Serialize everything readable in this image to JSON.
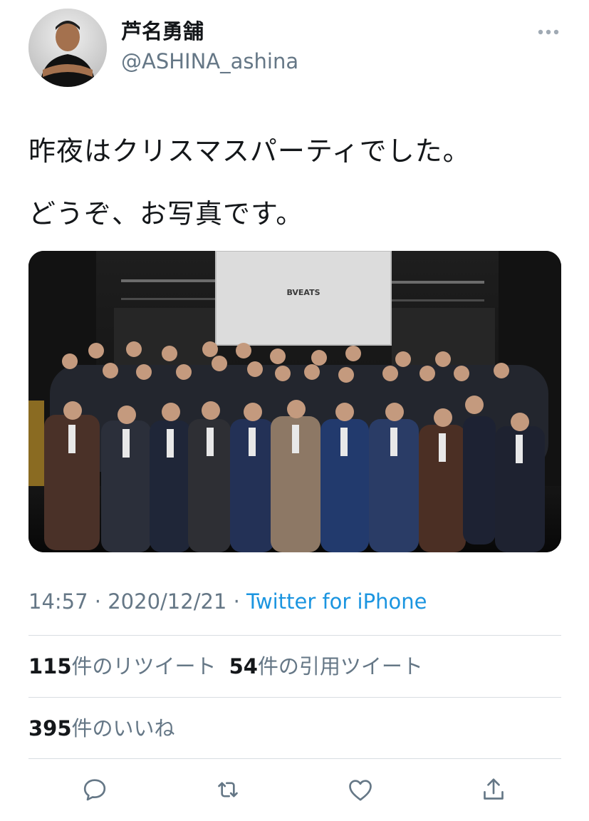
{
  "user": {
    "display_name": "芦名勇舗",
    "handle": "@ASHINA_ashina",
    "avatar_icon": "profile-photo"
  },
  "header": {
    "more_icon": "more-horizontal-icon"
  },
  "tweet": {
    "lines": [
      "昨夜はクリスマスパーティでした。",
      "どうぞ、お写真です。"
    ]
  },
  "photo": {
    "screen_text": "BVEATS"
  },
  "meta": {
    "time": "14:57",
    "sep1": " · ",
    "date": "2020/12/21",
    "sep2": " · ",
    "source": "Twitter for iPhone"
  },
  "stats": {
    "retweets_count": "115",
    "retweets_label": "件のリツイート",
    "quotes_count": "54",
    "quotes_label": "件の引用ツイート",
    "likes_count": "395",
    "likes_label": "件のいいね"
  },
  "actions": {
    "reply_icon": "reply-icon",
    "retweet_icon": "retweet-icon",
    "like_icon": "like-icon",
    "share_icon": "share-icon"
  },
  "colors": {
    "text": "#14171a",
    "secondary": "#657786",
    "link": "#1b95e0",
    "divider": "#d8dde1"
  }
}
